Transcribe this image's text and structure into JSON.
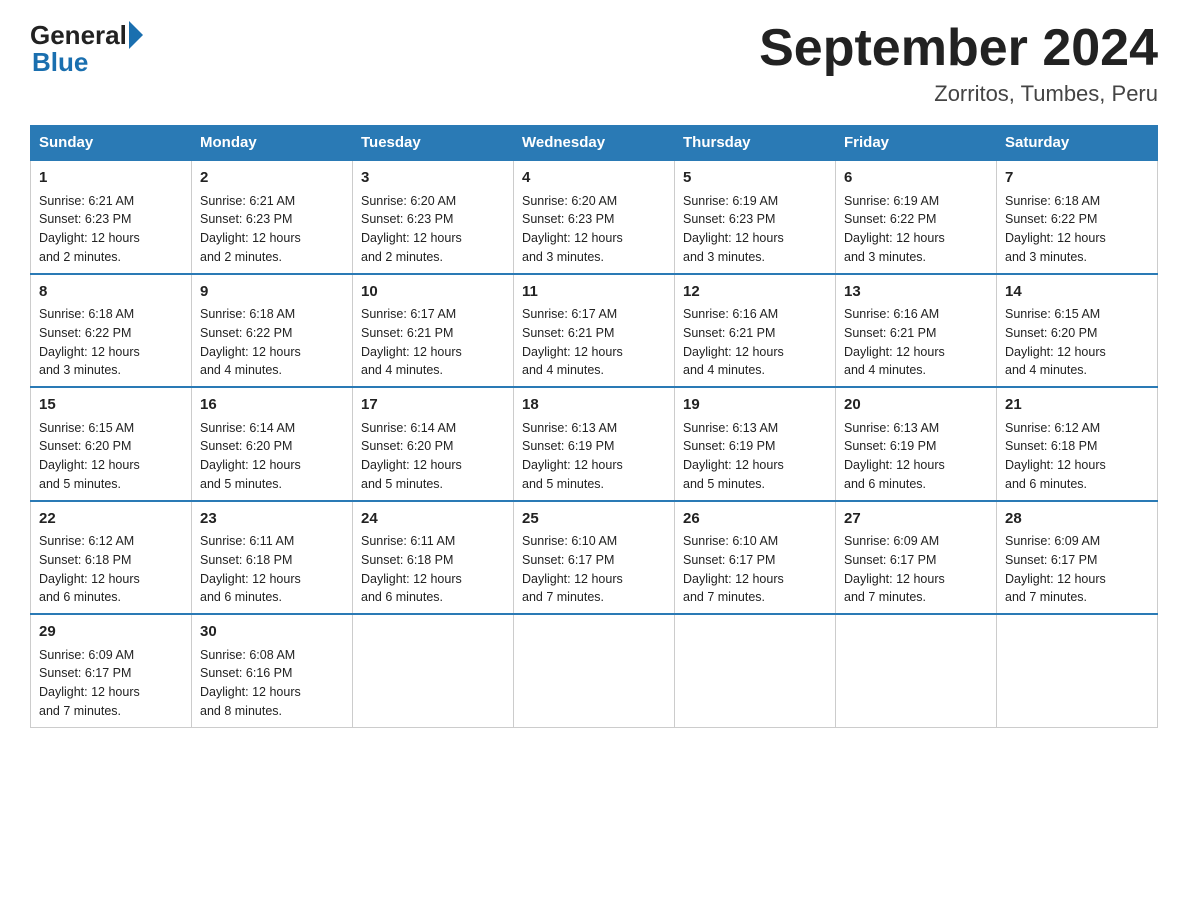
{
  "header": {
    "logo_general": "General",
    "logo_blue": "Blue",
    "title": "September 2024",
    "location": "Zorritos, Tumbes, Peru"
  },
  "days_of_week": [
    "Sunday",
    "Monday",
    "Tuesday",
    "Wednesday",
    "Thursday",
    "Friday",
    "Saturday"
  ],
  "weeks": [
    [
      {
        "day": "1",
        "sunrise": "6:21 AM",
        "sunset": "6:23 PM",
        "daylight": "12 hours and 2 minutes."
      },
      {
        "day": "2",
        "sunrise": "6:21 AM",
        "sunset": "6:23 PM",
        "daylight": "12 hours and 2 minutes."
      },
      {
        "day": "3",
        "sunrise": "6:20 AM",
        "sunset": "6:23 PM",
        "daylight": "12 hours and 2 minutes."
      },
      {
        "day": "4",
        "sunrise": "6:20 AM",
        "sunset": "6:23 PM",
        "daylight": "12 hours and 3 minutes."
      },
      {
        "day": "5",
        "sunrise": "6:19 AM",
        "sunset": "6:23 PM",
        "daylight": "12 hours and 3 minutes."
      },
      {
        "day": "6",
        "sunrise": "6:19 AM",
        "sunset": "6:22 PM",
        "daylight": "12 hours and 3 minutes."
      },
      {
        "day": "7",
        "sunrise": "6:18 AM",
        "sunset": "6:22 PM",
        "daylight": "12 hours and 3 minutes."
      }
    ],
    [
      {
        "day": "8",
        "sunrise": "6:18 AM",
        "sunset": "6:22 PM",
        "daylight": "12 hours and 3 minutes."
      },
      {
        "day": "9",
        "sunrise": "6:18 AM",
        "sunset": "6:22 PM",
        "daylight": "12 hours and 4 minutes."
      },
      {
        "day": "10",
        "sunrise": "6:17 AM",
        "sunset": "6:21 PM",
        "daylight": "12 hours and 4 minutes."
      },
      {
        "day": "11",
        "sunrise": "6:17 AM",
        "sunset": "6:21 PM",
        "daylight": "12 hours and 4 minutes."
      },
      {
        "day": "12",
        "sunrise": "6:16 AM",
        "sunset": "6:21 PM",
        "daylight": "12 hours and 4 minutes."
      },
      {
        "day": "13",
        "sunrise": "6:16 AM",
        "sunset": "6:21 PM",
        "daylight": "12 hours and 4 minutes."
      },
      {
        "day": "14",
        "sunrise": "6:15 AM",
        "sunset": "6:20 PM",
        "daylight": "12 hours and 4 minutes."
      }
    ],
    [
      {
        "day": "15",
        "sunrise": "6:15 AM",
        "sunset": "6:20 PM",
        "daylight": "12 hours and 5 minutes."
      },
      {
        "day": "16",
        "sunrise": "6:14 AM",
        "sunset": "6:20 PM",
        "daylight": "12 hours and 5 minutes."
      },
      {
        "day": "17",
        "sunrise": "6:14 AM",
        "sunset": "6:20 PM",
        "daylight": "12 hours and 5 minutes."
      },
      {
        "day": "18",
        "sunrise": "6:13 AM",
        "sunset": "6:19 PM",
        "daylight": "12 hours and 5 minutes."
      },
      {
        "day": "19",
        "sunrise": "6:13 AM",
        "sunset": "6:19 PM",
        "daylight": "12 hours and 5 minutes."
      },
      {
        "day": "20",
        "sunrise": "6:13 AM",
        "sunset": "6:19 PM",
        "daylight": "12 hours and 6 minutes."
      },
      {
        "day": "21",
        "sunrise": "6:12 AM",
        "sunset": "6:18 PM",
        "daylight": "12 hours and 6 minutes."
      }
    ],
    [
      {
        "day": "22",
        "sunrise": "6:12 AM",
        "sunset": "6:18 PM",
        "daylight": "12 hours and 6 minutes."
      },
      {
        "day": "23",
        "sunrise": "6:11 AM",
        "sunset": "6:18 PM",
        "daylight": "12 hours and 6 minutes."
      },
      {
        "day": "24",
        "sunrise": "6:11 AM",
        "sunset": "6:18 PM",
        "daylight": "12 hours and 6 minutes."
      },
      {
        "day": "25",
        "sunrise": "6:10 AM",
        "sunset": "6:17 PM",
        "daylight": "12 hours and 7 minutes."
      },
      {
        "day": "26",
        "sunrise": "6:10 AM",
        "sunset": "6:17 PM",
        "daylight": "12 hours and 7 minutes."
      },
      {
        "day": "27",
        "sunrise": "6:09 AM",
        "sunset": "6:17 PM",
        "daylight": "12 hours and 7 minutes."
      },
      {
        "day": "28",
        "sunrise": "6:09 AM",
        "sunset": "6:17 PM",
        "daylight": "12 hours and 7 minutes."
      }
    ],
    [
      {
        "day": "29",
        "sunrise": "6:09 AM",
        "sunset": "6:17 PM",
        "daylight": "12 hours and 7 minutes."
      },
      {
        "day": "30",
        "sunrise": "6:08 AM",
        "sunset": "6:16 PM",
        "daylight": "12 hours and 8 minutes."
      },
      null,
      null,
      null,
      null,
      null
    ]
  ],
  "labels": {
    "sunrise": "Sunrise:",
    "sunset": "Sunset:",
    "daylight": "Daylight:"
  }
}
